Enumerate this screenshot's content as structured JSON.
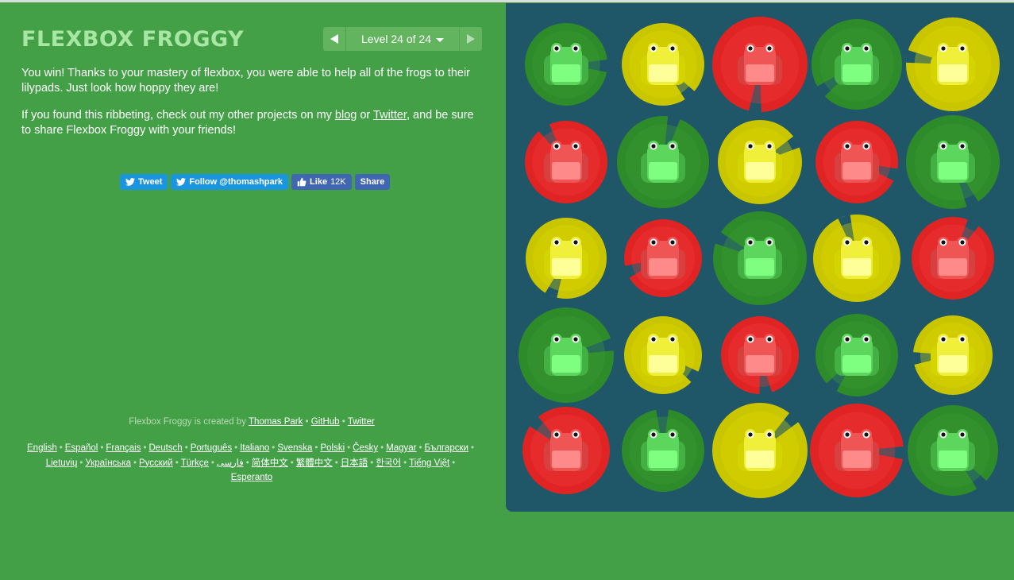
{
  "header": {
    "title": "FLEXBOX FROGGY",
    "level_label": "Level 24 of 24",
    "prev_icon": "triangle-left-icon",
    "next_icon": "triangle-right-icon"
  },
  "win": {
    "p1": "You win! Thanks to your mastery of flexbox, you were able to help all of the frogs to their lilypads. Just look how hoppy they are!",
    "p2_before": "If you found this ribbeting, check out my other projects on my ",
    "p2_blog": "blog",
    "p2_or": " or ",
    "p2_twitter": "Twitter",
    "p2_after": ", and be sure to share Flexbox Froggy with your friends!"
  },
  "social": {
    "tweet": "Tweet",
    "follow": "Follow @thomashpark",
    "like": "Like",
    "like_count": "12K",
    "share": "Share"
  },
  "credits": {
    "prefix": "Flexbox Froggy is created by",
    "author": "Thomas Park",
    "github": "GitHub",
    "twitter": "Twitter"
  },
  "languages": [
    "English",
    "Español",
    "Français",
    "Deutsch",
    "Português",
    "Italiano",
    "Svenska",
    "Polski",
    "Česky",
    "Magyar",
    "Български",
    "Lietuvių",
    "Українська",
    "Русский",
    "Türkçe",
    "فارسی",
    "简体中文",
    "繁體中文",
    "日本語",
    "한국어",
    "Tiếng Việt",
    "Esperanto"
  ],
  "colors": {
    "background": "#43a047",
    "board": "#1f5768",
    "green_pad": "#2e8b2a",
    "green_frog": "#5cd65c",
    "yellow_pad": "#c9c600",
    "yellow_frog": "#f0f03a",
    "red_pad": "#e02424",
    "red_frog": "#f05555"
  },
  "board": {
    "frogs": [
      [
        "green",
        "yellow",
        "red",
        "green",
        "yellow"
      ],
      [
        "red",
        "green",
        "yellow",
        "red",
        "green"
      ],
      [
        "yellow",
        "red",
        "green",
        "yellow",
        "red"
      ],
      [
        "green",
        "yellow",
        "red",
        "green",
        "yellow"
      ],
      [
        "red",
        "green",
        "yellow",
        "red",
        "green"
      ]
    ]
  }
}
